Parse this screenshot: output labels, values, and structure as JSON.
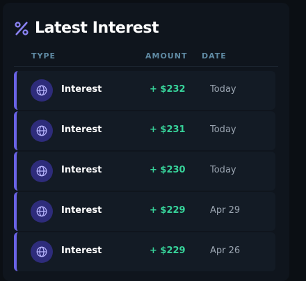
{
  "header": {
    "icon": "percent-icon",
    "title": "Latest Interest"
  },
  "columns": {
    "type": "TYPE",
    "amount": "AMOUNT",
    "date": "DATE"
  },
  "rows": [
    {
      "icon": "globe-icon",
      "type": "Interest",
      "amount": "+ $232",
      "date": "Today"
    },
    {
      "icon": "globe-icon",
      "type": "Interest",
      "amount": "+ $231",
      "date": "Today"
    },
    {
      "icon": "globe-icon",
      "type": "Interest",
      "amount": "+ $230",
      "date": "Today"
    },
    {
      "icon": "globe-icon",
      "type": "Interest",
      "amount": "+ $229",
      "date": "Apr 29"
    },
    {
      "icon": "globe-icon",
      "type": "Interest",
      "amount": "+ $229",
      "date": "Apr 26"
    }
  ],
  "colors": {
    "accent": "#6a63e6",
    "positive": "#37d39a",
    "background": "#0f151d",
    "row": "#131b25"
  }
}
